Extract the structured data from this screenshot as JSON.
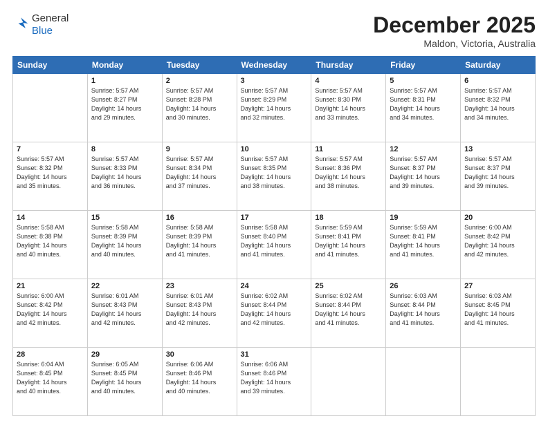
{
  "header": {
    "logo": {
      "line1": "General",
      "line2": "Blue"
    },
    "title": "December 2025",
    "location": "Maldon, Victoria, Australia"
  },
  "days_of_week": [
    "Sunday",
    "Monday",
    "Tuesday",
    "Wednesday",
    "Thursday",
    "Friday",
    "Saturday"
  ],
  "weeks": [
    [
      {
        "day": "",
        "info": ""
      },
      {
        "day": "1",
        "info": "Sunrise: 5:57 AM\nSunset: 8:27 PM\nDaylight: 14 hours\nand 29 minutes."
      },
      {
        "day": "2",
        "info": "Sunrise: 5:57 AM\nSunset: 8:28 PM\nDaylight: 14 hours\nand 30 minutes."
      },
      {
        "day": "3",
        "info": "Sunrise: 5:57 AM\nSunset: 8:29 PM\nDaylight: 14 hours\nand 32 minutes."
      },
      {
        "day": "4",
        "info": "Sunrise: 5:57 AM\nSunset: 8:30 PM\nDaylight: 14 hours\nand 33 minutes."
      },
      {
        "day": "5",
        "info": "Sunrise: 5:57 AM\nSunset: 8:31 PM\nDaylight: 14 hours\nand 34 minutes."
      },
      {
        "day": "6",
        "info": "Sunrise: 5:57 AM\nSunset: 8:32 PM\nDaylight: 14 hours\nand 34 minutes."
      }
    ],
    [
      {
        "day": "7",
        "info": "Sunrise: 5:57 AM\nSunset: 8:32 PM\nDaylight: 14 hours\nand 35 minutes."
      },
      {
        "day": "8",
        "info": "Sunrise: 5:57 AM\nSunset: 8:33 PM\nDaylight: 14 hours\nand 36 minutes."
      },
      {
        "day": "9",
        "info": "Sunrise: 5:57 AM\nSunset: 8:34 PM\nDaylight: 14 hours\nand 37 minutes."
      },
      {
        "day": "10",
        "info": "Sunrise: 5:57 AM\nSunset: 8:35 PM\nDaylight: 14 hours\nand 38 minutes."
      },
      {
        "day": "11",
        "info": "Sunrise: 5:57 AM\nSunset: 8:36 PM\nDaylight: 14 hours\nand 38 minutes."
      },
      {
        "day": "12",
        "info": "Sunrise: 5:57 AM\nSunset: 8:37 PM\nDaylight: 14 hours\nand 39 minutes."
      },
      {
        "day": "13",
        "info": "Sunrise: 5:57 AM\nSunset: 8:37 PM\nDaylight: 14 hours\nand 39 minutes."
      }
    ],
    [
      {
        "day": "14",
        "info": "Sunrise: 5:58 AM\nSunset: 8:38 PM\nDaylight: 14 hours\nand 40 minutes."
      },
      {
        "day": "15",
        "info": "Sunrise: 5:58 AM\nSunset: 8:39 PM\nDaylight: 14 hours\nand 40 minutes."
      },
      {
        "day": "16",
        "info": "Sunrise: 5:58 AM\nSunset: 8:39 PM\nDaylight: 14 hours\nand 41 minutes."
      },
      {
        "day": "17",
        "info": "Sunrise: 5:58 AM\nSunset: 8:40 PM\nDaylight: 14 hours\nand 41 minutes."
      },
      {
        "day": "18",
        "info": "Sunrise: 5:59 AM\nSunset: 8:41 PM\nDaylight: 14 hours\nand 41 minutes."
      },
      {
        "day": "19",
        "info": "Sunrise: 5:59 AM\nSunset: 8:41 PM\nDaylight: 14 hours\nand 41 minutes."
      },
      {
        "day": "20",
        "info": "Sunrise: 6:00 AM\nSunset: 8:42 PM\nDaylight: 14 hours\nand 42 minutes."
      }
    ],
    [
      {
        "day": "21",
        "info": "Sunrise: 6:00 AM\nSunset: 8:42 PM\nDaylight: 14 hours\nand 42 minutes."
      },
      {
        "day": "22",
        "info": "Sunrise: 6:01 AM\nSunset: 8:43 PM\nDaylight: 14 hours\nand 42 minutes."
      },
      {
        "day": "23",
        "info": "Sunrise: 6:01 AM\nSunset: 8:43 PM\nDaylight: 14 hours\nand 42 minutes."
      },
      {
        "day": "24",
        "info": "Sunrise: 6:02 AM\nSunset: 8:44 PM\nDaylight: 14 hours\nand 42 minutes."
      },
      {
        "day": "25",
        "info": "Sunrise: 6:02 AM\nSunset: 8:44 PM\nDaylight: 14 hours\nand 41 minutes."
      },
      {
        "day": "26",
        "info": "Sunrise: 6:03 AM\nSunset: 8:44 PM\nDaylight: 14 hours\nand 41 minutes."
      },
      {
        "day": "27",
        "info": "Sunrise: 6:03 AM\nSunset: 8:45 PM\nDaylight: 14 hours\nand 41 minutes."
      }
    ],
    [
      {
        "day": "28",
        "info": "Sunrise: 6:04 AM\nSunset: 8:45 PM\nDaylight: 14 hours\nand 40 minutes."
      },
      {
        "day": "29",
        "info": "Sunrise: 6:05 AM\nSunset: 8:45 PM\nDaylight: 14 hours\nand 40 minutes."
      },
      {
        "day": "30",
        "info": "Sunrise: 6:06 AM\nSunset: 8:46 PM\nDaylight: 14 hours\nand 40 minutes."
      },
      {
        "day": "31",
        "info": "Sunrise: 6:06 AM\nSunset: 8:46 PM\nDaylight: 14 hours\nand 39 minutes."
      },
      {
        "day": "",
        "info": ""
      },
      {
        "day": "",
        "info": ""
      },
      {
        "day": "",
        "info": ""
      }
    ]
  ]
}
